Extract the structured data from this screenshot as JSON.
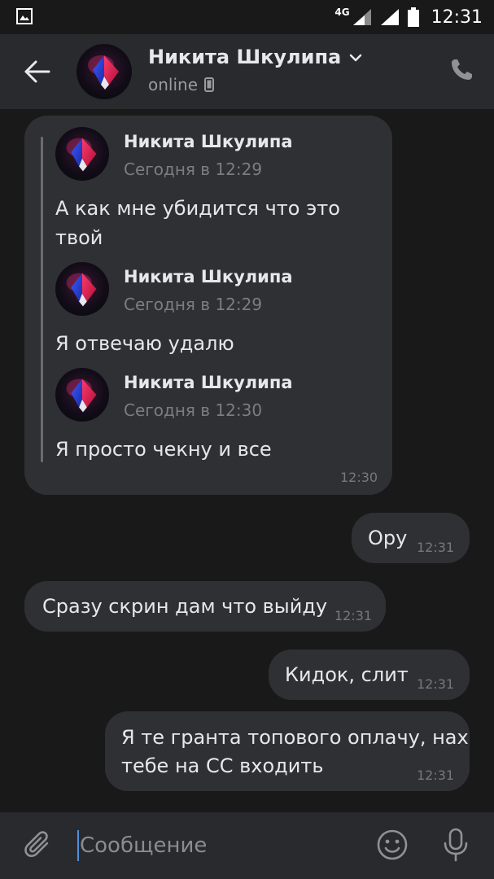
{
  "status_bar": {
    "network": "4G",
    "time": "12:31"
  },
  "header": {
    "name": "Никита Шкулипа",
    "status": "online"
  },
  "messages": [
    {
      "side": "left",
      "forwarded": [
        {
          "name": "Никита Шкулипа",
          "date": "Сегодня в 12:29",
          "text_lines": [
            "А как мне убидится что это",
            "твой"
          ]
        },
        {
          "name": "Никита Шкулипа",
          "date": "Сегодня в 12:29",
          "text_lines": [
            "Я отвечаю удалю"
          ]
        },
        {
          "name": "Никита Шкулипа",
          "date": "Сегодня в 12:30",
          "text_lines": [
            "Я просто чекну и все"
          ]
        }
      ],
      "time": "12:30"
    },
    {
      "side": "right",
      "text": "Ору",
      "time": "12:31"
    },
    {
      "side": "left",
      "text": "Сразу скрин дам что выйду",
      "time": "12:31"
    },
    {
      "side": "right",
      "text": "Кидок, слит",
      "time": "12:31"
    },
    {
      "side": "right",
      "text_lines": [
        "Я те гранта топового оплачу, нах",
        "тебе на СС входить"
      ],
      "time": "12:31"
    }
  ],
  "composer": {
    "placeholder": "Сообщение"
  },
  "icons": {
    "back": "arrow-left-icon",
    "call": "phone-icon",
    "attach": "paperclip-icon",
    "emoji": "smiley-icon",
    "mic": "microphone-icon"
  },
  "colors": {
    "background": "#19191a",
    "bar": "#292a2d",
    "bubble": "#2f3033"
  }
}
